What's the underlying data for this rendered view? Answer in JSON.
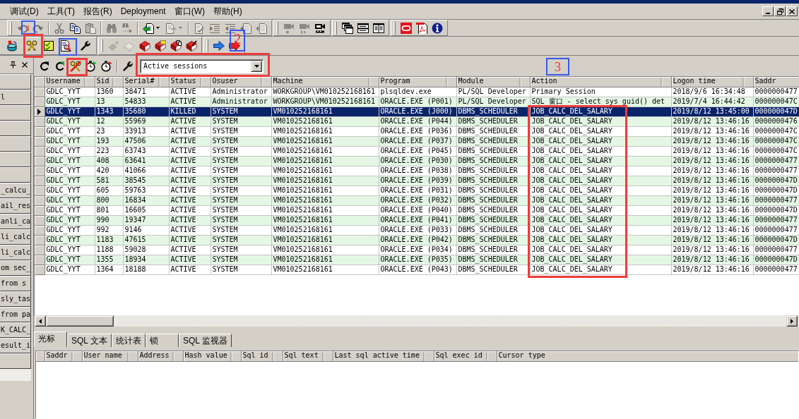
{
  "menu_bar": {
    "items": [
      "调试(D)",
      "工具(T)",
      "报告(R)",
      "Deployment",
      "窗口(W)",
      "帮助(H)"
    ]
  },
  "toolbars": [
    {
      "bands": [
        {
          "items": [
            {
              "kind": "undo",
              "disabled": true
            },
            {
              "kind": "redo",
              "disabled": true
            },
            {
              "kind": "separator"
            },
            {
              "kind": "cut",
              "disabled": true
            },
            {
              "kind": "copy",
              "disabled": false
            },
            {
              "kind": "paste",
              "disabled": true
            },
            {
              "kind": "separator"
            },
            {
              "kind": "find",
              "disabled": true
            },
            {
              "kind": "findnext",
              "disabled": true
            },
            {
              "kind": "separator"
            },
            {
              "kind": "load",
              "disabled": false,
              "menu": true
            },
            {
              "kind": "export",
              "disabled": true,
              "menu": true
            },
            {
              "kind": "separator"
            },
            {
              "kind": "doccheck",
              "disabled": true
            },
            {
              "kind": "indent",
              "disabled": true
            },
            {
              "kind": "outdent",
              "disabled": true
            },
            {
              "kind": "docleft",
              "disabled": true
            },
            {
              "kind": "docright",
              "disabled": true
            }
          ]
        },
        {
          "items": [
            {
              "kind": "camera",
              "disabled": true
            },
            {
              "kind": "camerastep",
              "disabled": true
            },
            {
              "kind": "camerawatch",
              "disabled": false
            }
          ]
        },
        {
          "items": [
            {
              "kind": "cascade",
              "disabled": false
            },
            {
              "kind": "tileh",
              "disabled": false
            },
            {
              "kind": "tilev",
              "disabled": false
            }
          ]
        },
        {
          "items": [
            {
              "kind": "ring",
              "disabled": false
            },
            {
              "kind": "pdf",
              "disabled": false
            },
            {
              "kind": "info",
              "disabled": false
            }
          ]
        }
      ]
    },
    {
      "bands": [
        {
          "items": [
            {
              "kind": "dbcross",
              "disabled": false
            },
            {
              "kind": "keys",
              "disabled": false
            },
            {
              "kind": "checklist",
              "disabled": false
            },
            {
              "kind": "docsearch",
              "disabled": false
            },
            {
              "kind": "wrench",
              "disabled": false
            }
          ]
        },
        {
          "items": [
            {
              "kind": "sparkle",
              "disabled": true
            },
            {
              "kind": "eraser",
              "disabled": true
            },
            {
              "kind": "book",
              "disabled": false
            },
            {
              "kind": "booknote",
              "disabled": false
            },
            {
              "kind": "bookcopy",
              "disabled": false
            },
            {
              "kind": "bookbrush",
              "disabled": false
            }
          ]
        },
        {
          "items": [
            {
              "kind": "arrow",
              "disabled": false
            },
            {
              "kind": "exit",
              "disabled": false
            }
          ]
        }
      ]
    }
  ],
  "side_panel": {
    "items": [
      {
        "kind": "blank"
      },
      {
        "kind": "text",
        "label": "l"
      },
      {
        "kind": "blank"
      },
      {
        "kind": "blank"
      },
      {
        "kind": "blank"
      },
      {
        "kind": "blank"
      },
      {
        "kind": "blank"
      },
      {
        "kind": "text",
        "label": "_calcu_"
      },
      {
        "kind": "text",
        "label": "ail_res"
      },
      {
        "kind": "text",
        "label": "anli_ca"
      },
      {
        "kind": "text",
        "label": "li_calc"
      },
      {
        "kind": "text",
        "label": "li_calc"
      },
      {
        "kind": "text",
        "label": "om sec_"
      },
      {
        "kind": "text",
        "label": "from s"
      },
      {
        "kind": "text",
        "label": "sly_tas"
      },
      {
        "kind": "text",
        "label": "from pa"
      },
      {
        "kind": "text",
        "label": "K_CALC_"
      },
      {
        "kind": "text",
        "label": "esult_i"
      },
      {
        "kind": "blank"
      }
    ]
  },
  "sessions": {
    "toolbar": [
      {
        "kind": "refresh",
        "disabled": false
      },
      {
        "kind": "autorefresh",
        "disabled": false
      },
      {
        "kind": "keyslash",
        "disabled": false
      },
      {
        "kind": "timergo",
        "disabled": false
      },
      {
        "kind": "timerstop",
        "disabled": false
      },
      {
        "kind": "separator"
      },
      {
        "kind": "wrench",
        "disabled": false
      }
    ],
    "filter": {
      "value": "Active sessions"
    },
    "grid": {
      "columns": [
        "Username",
        "Sid",
        "Serial#",
        "Status",
        "Osuser",
        "Machine",
        "Program",
        "Module",
        "Action",
        "Logon time",
        "Saddr"
      ],
      "rows": [
        {
          "selected": false,
          "cells": [
            "GDLC_YYT",
            "1360",
            "38471",
            "ACTIVE",
            "Administrator",
            "WORKGROUP\\VM010252168161",
            "plsqldev.exe",
            "PL/SQL Developer",
            "Primary Session",
            "2018/9/6 16:34:48",
            "0000000477"
          ]
        },
        {
          "selected": false,
          "cells": [
            "GDLC_YYT",
            "13",
            "54833",
            "ACTIVE",
            "Administrator",
            "WORKGROUP\\VM010252168161",
            "ORACLE.EXE (P001)",
            "PL/SQL Developer",
            "SQL 窗口 - select sys_guid() det",
            "2019/7/4 16:44:42",
            "000000047C"
          ]
        },
        {
          "selected": true,
          "cells": [
            "GDLC_YYT",
            "1343",
            "35680",
            "KILLED",
            "SYSTEM",
            "VM010252168161",
            "ORACLE.EXE (J000)",
            "DBMS_SCHEDULER",
            "JOB_CALC_DEL_SALARY",
            "2019/8/12 13:45:00",
            "000000047D"
          ]
        },
        {
          "selected": false,
          "cells": [
            "GDLC_YYT",
            "12",
            "55969",
            "ACTIVE",
            "SYSTEM",
            "VM010252168161",
            "ORACLE.EXE (P044)",
            "DBMS_SCHEDULER",
            "JOB_CALC_DEL_SALARY",
            "2019/8/12 13:46:16",
            "0000000476"
          ]
        },
        {
          "selected": false,
          "cells": [
            "GDLC_YYT",
            "23",
            "33913",
            "ACTIVE",
            "SYSTEM",
            "VM010252168161",
            "ORACLE.EXE (P036)",
            "DBMS_SCHEDULER",
            "JOB_CALC_DEL_SALARY",
            "2019/8/12 13:46:16",
            "000000047C"
          ]
        },
        {
          "selected": false,
          "cells": [
            "GDLC_YYT",
            "193",
            "47506",
            "ACTIVE",
            "SYSTEM",
            "VM010252168161",
            "ORACLE.EXE (P037)",
            "DBMS_SCHEDULER",
            "JOB_CALC_DEL_SALARY",
            "2019/8/12 13:46:16",
            "000000047C"
          ]
        },
        {
          "selected": false,
          "cells": [
            "GDLC_YYT",
            "223",
            "63743",
            "ACTIVE",
            "SYSTEM",
            "VM010252168161",
            "ORACLE.EXE (P045)",
            "DBMS_SCHEDULER",
            "JOB_CALC_DEL_SALARY",
            "2019/8/12 13:46:16",
            "000000047C"
          ]
        },
        {
          "selected": false,
          "cells": [
            "GDLC_YYT",
            "408",
            "63641",
            "ACTIVE",
            "SYSTEM",
            "VM010252168161",
            "ORACLE.EXE (P030)",
            "DBMS_SCHEDULER",
            "JOB_CALC_DEL_SALARY",
            "2019/8/12 13:46:16",
            "0000000477"
          ]
        },
        {
          "selected": false,
          "cells": [
            "GDLC_YYT",
            "420",
            "41066",
            "ACTIVE",
            "SYSTEM",
            "VM010252168161",
            "ORACLE.EXE (P038)",
            "DBMS_SCHEDULER",
            "JOB_CALC_DEL_SALARY",
            "2019/8/12 13:46:16",
            "0000000477"
          ]
        },
        {
          "selected": false,
          "cells": [
            "GDLC_YYT",
            "581",
            "38545",
            "ACTIVE",
            "SYSTEM",
            "VM010252168161",
            "ORACLE.EXE (P039)",
            "DBMS_SCHEDULER",
            "JOB_CALC_DEL_SALARY",
            "2019/8/12 13:46:16",
            "000000047D"
          ]
        },
        {
          "selected": false,
          "cells": [
            "GDLC_YYT",
            "605",
            "59763",
            "ACTIVE",
            "SYSTEM",
            "VM010252168161",
            "ORACLE.EXE (P031)",
            "DBMS_SCHEDULER",
            "JOB_CALC_DEL_SALARY",
            "2019/8/12 13:46:16",
            "000000047D"
          ]
        },
        {
          "selected": false,
          "cells": [
            "GDLC_YYT",
            "800",
            "16834",
            "ACTIVE",
            "SYSTEM",
            "VM010252168161",
            "ORACLE.EXE (P032)",
            "DBMS_SCHEDULER",
            "JOB_CALC_DEL_SALARY",
            "2019/8/12 13:46:16",
            "0000000477"
          ]
        },
        {
          "selected": false,
          "cells": [
            "GDLC_YYT",
            "801",
            "16605",
            "ACTIVE",
            "SYSTEM",
            "VM010252168161",
            "ORACLE.EXE (P040)",
            "DBMS_SCHEDULER",
            "JOB_CALC_DEL_SALARY",
            "2019/8/12 13:46:16",
            "000000047D"
          ]
        },
        {
          "selected": false,
          "cells": [
            "GDLC_YYT",
            "990",
            "19347",
            "ACTIVE",
            "SYSTEM",
            "VM010252168161",
            "ORACLE.EXE (P041)",
            "DBMS_SCHEDULER",
            "JOB_CALC_DEL_SALARY",
            "2019/8/12 13:46:16",
            "0000000477"
          ]
        },
        {
          "selected": false,
          "cells": [
            "GDLC_YYT",
            "992",
            "9146",
            "ACTIVE",
            "SYSTEM",
            "VM010252168161",
            "ORACLE.EXE (P033)",
            "DBMS_SCHEDULER",
            "JOB_CALC_DEL_SALARY",
            "2019/8/12 13:46:16",
            "0000000477"
          ]
        },
        {
          "selected": false,
          "cells": [
            "GDLC_YYT",
            "1183",
            "47615",
            "ACTIVE",
            "SYSTEM",
            "VM010252168161",
            "ORACLE.EXE (P042)",
            "DBMS_SCHEDULER",
            "JOB_CALC_DEL_SALARY",
            "2019/8/12 13:46:16",
            "000000047D"
          ]
        },
        {
          "selected": false,
          "cells": [
            "GDLC_YYT",
            "1188",
            "59028",
            "ACTIVE",
            "SYSTEM",
            "VM010252168161",
            "ORACLE.EXE (P034)",
            "DBMS_SCHEDULER",
            "JOB_CALC_DEL_SALARY",
            "2019/8/12 13:46:16",
            "0000000477"
          ]
        },
        {
          "selected": false,
          "cells": [
            "GDLC_YYT",
            "1355",
            "18934",
            "ACTIVE",
            "SYSTEM",
            "VM010252168161",
            "ORACLE.EXE (P035)",
            "DBMS_SCHEDULER",
            "JOB_CALC_DEL_SALARY",
            "2019/8/12 13:46:16",
            "000000047D"
          ]
        },
        {
          "selected": false,
          "cells": [
            "GDLC_YYT",
            "1364",
            "18188",
            "ACTIVE",
            "SYSTEM",
            "VM010252168161",
            "ORACLE.EXE (P043)",
            "DBMS_SCHEDULER",
            "JOB_CALC_DEL_SALARY",
            "2019/8/12 13:46:16",
            "0000000477"
          ]
        }
      ]
    }
  },
  "details": {
    "tabs": [
      {
        "label": "光标",
        "selected": true
      },
      {
        "label": "SQL 文本",
        "selected": false
      },
      {
        "label": "统计表",
        "selected": false
      },
      {
        "label": "锁",
        "selected": false
      },
      {
        "label": "SQL 监视器",
        "selected": false
      }
    ],
    "grid": {
      "columns": [
        "Saddr",
        "User name",
        "Address",
        "Hash value",
        "Sql id",
        "Sql text",
        "Last sql active time",
        "Sql exec id",
        "Cursor type"
      ]
    }
  },
  "annotations": [
    {
      "kind": "marker",
      "label": "1"
    },
    {
      "kind": "marker",
      "label": "2"
    },
    {
      "kind": "frame"
    },
    {
      "kind": "marker",
      "label": "4"
    },
    {
      "kind": "frame"
    },
    {
      "kind": "frame"
    },
    {
      "kind": "marker",
      "label": "3"
    },
    {
      "kind": "frame"
    }
  ]
}
